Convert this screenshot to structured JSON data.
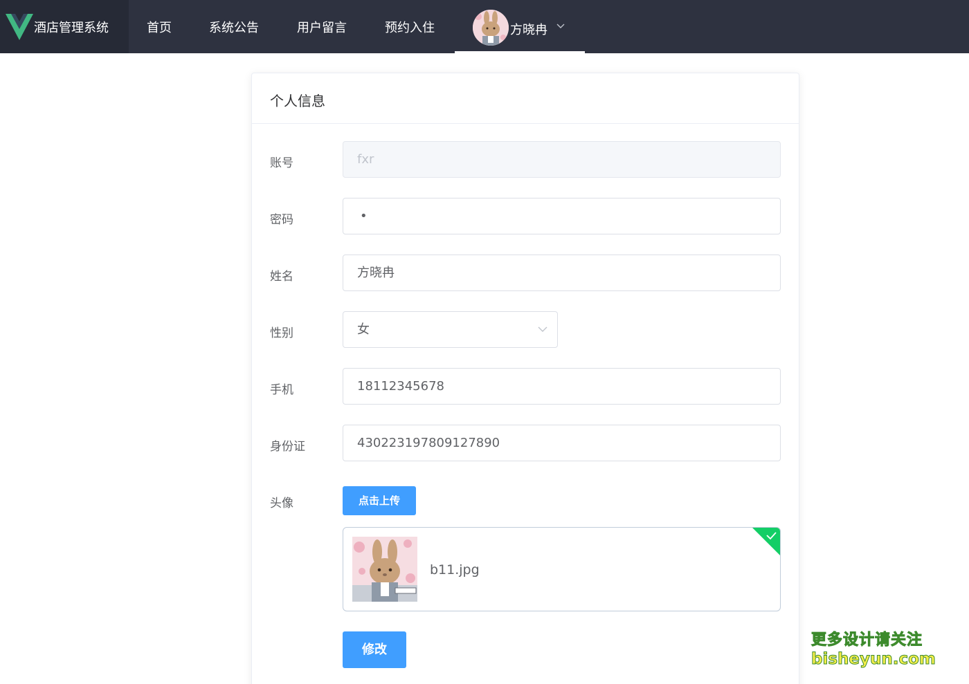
{
  "app": {
    "title": "酒店管理系统",
    "logo": "vue-logo-icon"
  },
  "nav": {
    "items": [
      {
        "label": "首页"
      },
      {
        "label": "系统公告"
      },
      {
        "label": "用户留言"
      },
      {
        "label": "预约入住"
      }
    ],
    "user": {
      "name": "方晓冉",
      "avatar": "bunny-avatar",
      "caret": "chevron-down-icon"
    }
  },
  "card": {
    "title": "个人信息",
    "fields": {
      "account": {
        "label": "账号",
        "value": "fxr"
      },
      "password": {
        "label": "密码",
        "value": "•"
      },
      "name": {
        "label": "姓名",
        "value": "方晓冉"
      },
      "gender": {
        "label": "性别",
        "value": "女"
      },
      "phone": {
        "label": "手机",
        "value": "18112345678"
      },
      "idcard": {
        "label": "身份证",
        "value": "430223197809127890"
      },
      "avatar": {
        "label": "头像",
        "upload_button": "点击上传",
        "file_name": "b11.jpg",
        "status": "success"
      }
    },
    "submit_label": "修改"
  },
  "watermark": {
    "line1": "更多设计请关注",
    "line2": "bisheyun.com"
  },
  "colors": {
    "nav_bg": "#2e3240",
    "brand_bg": "#262a36",
    "primary": "#409eff",
    "success": "#13ce66",
    "logo_green": "#41b883"
  }
}
